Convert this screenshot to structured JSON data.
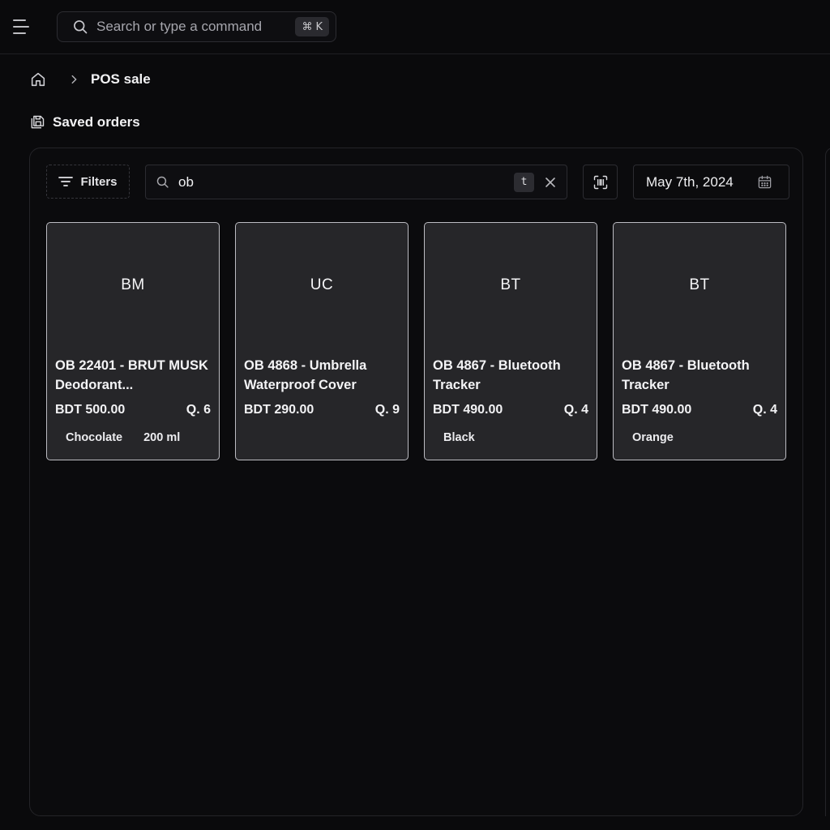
{
  "topbar": {
    "search_placeholder": "Search or type a command",
    "shortcut_symbol": "⌘",
    "shortcut_key": "K"
  },
  "breadcrumb": {
    "current": "POS sale"
  },
  "section": {
    "title": "Saved orders"
  },
  "toolbar": {
    "filters_label": "Filters",
    "search_value": "ob",
    "search_badge": "t",
    "date_label": "May 7th, 2024"
  },
  "products": [
    {
      "initials": "BM",
      "name": "OB 22401 - BRUT MUSK Deodorant...",
      "price": "BDT 500.00",
      "qty": "Q. 6",
      "attr1": "Chocolate",
      "attr2": "200 ml"
    },
    {
      "initials": "UC",
      "name": "OB 4868 - Umbrella Waterproof Cover",
      "price": "BDT 290.00",
      "qty": "Q. 9",
      "attr1": "",
      "attr2": ""
    },
    {
      "initials": "BT",
      "name": "OB 4867 - Bluetooth Tracker",
      "price": "BDT 490.00",
      "qty": "Q. 4",
      "attr1": "Black",
      "attr2": ""
    },
    {
      "initials": "BT",
      "name": "OB 4867 - Bluetooth Tracker",
      "price": "BDT 490.00",
      "qty": "Q. 4",
      "attr1": "Orange",
      "attr2": ""
    }
  ]
}
